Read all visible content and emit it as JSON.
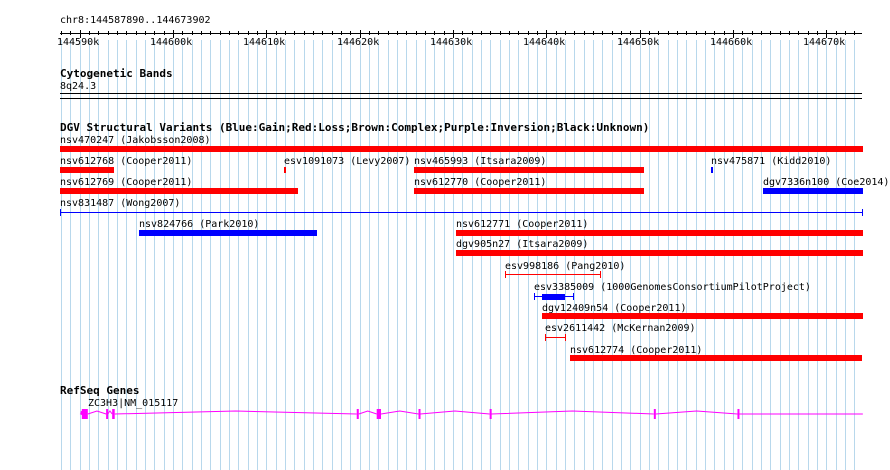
{
  "ruler": {
    "location": "chr8:144587890..144673902",
    "ticks": [
      "144590k",
      "144600k",
      "144610k",
      "144620k",
      "144630k",
      "144640k",
      "144650k",
      "144660k",
      "144670k"
    ]
  },
  "cytoband": {
    "title": "Cytogenetic Bands",
    "band": "8q24.3"
  },
  "dgv": {
    "title": "DGV Structural Variants (Blue:Gain;Red:Loss;Brown:Complex;Purple:Inversion;Black:Unknown)",
    "colors": {
      "gain": "#0000ff",
      "loss": "#ff0000"
    },
    "features": [
      {
        "label": "nsv470247 (Jakobsson2008)",
        "type": "loss",
        "start": 144587890,
        "end": 144673902,
        "style": "bar"
      },
      {
        "label": "nsv612768 (Cooper2011)",
        "type": "loss",
        "start": 144587890,
        "end": 144593650,
        "style": "bar"
      },
      {
        "label": "esv1091073 (Levy2007)",
        "type": "loss",
        "start": 144611910,
        "end": 144612050,
        "style": "bar"
      },
      {
        "label": "nsv465993 (Itsara2009)",
        "type": "loss",
        "start": 144625850,
        "end": 144650490,
        "style": "bar"
      },
      {
        "label": "nsv475871 (Kidd2010)",
        "type": "gain",
        "start": 144657670,
        "end": 144657830,
        "style": "bar"
      },
      {
        "label": "nsv612769 (Cooper2011)",
        "type": "loss",
        "start": 144587890,
        "end": 144613420,
        "style": "bar"
      },
      {
        "label": "nsv612770 (Cooper2011)",
        "type": "loss",
        "start": 144625850,
        "end": 144650490,
        "style": "bar"
      },
      {
        "label": "dgv7336n100 (Coe2014)",
        "type": "gain",
        "start": 144663180,
        "end": 144673902,
        "style": "bar"
      },
      {
        "label": "nsv831487 (Wong2007)",
        "type": "gain",
        "start": 144587890,
        "end": 144673902,
        "style": "line"
      },
      {
        "label": "nsv824766 (Park2010)",
        "type": "gain",
        "start": 144596320,
        "end": 144615400,
        "style": "bar"
      },
      {
        "label": "nsv612771 (Cooper2011)",
        "type": "loss",
        "start": 144630350,
        "end": 144673902,
        "style": "bar"
      },
      {
        "label": "dgv905n27 (Itsara2009)",
        "type": "loss",
        "start": 144630350,
        "end": 144673902,
        "style": "bar"
      },
      {
        "label": "esv998186 (Pang2010)",
        "type": "loss",
        "start": 144635540,
        "end": 144645830,
        "style": "line"
      },
      {
        "label": "esv3385009 (1000GenomesConsortiumPilotProject)",
        "type": "gain",
        "start": 144638620,
        "end": 144642900,
        "style": "line",
        "thick_start": 144639480,
        "thick_end": 144641940
      },
      {
        "label": "dgv12409n54 (Cooper2011)",
        "type": "loss",
        "start": 144639480,
        "end": 144673902,
        "style": "bar"
      },
      {
        "label": "esv2611442 (McKernan2009)",
        "type": "loss",
        "start": 144639800,
        "end": 144642040,
        "style": "line"
      },
      {
        "label": "nsv612774 (Cooper2011)",
        "type": "loss",
        "start": 144642580,
        "end": 144673902,
        "style": "bar"
      }
    ]
  },
  "refseq": {
    "title": "RefSeq Genes",
    "gene_label": "ZC3H3|NM_015117",
    "color": "#ff00ff",
    "start": 144590120,
    "end": 144673902,
    "exons": [
      [
        144590230,
        144590870
      ],
      [
        144592830,
        144593000
      ],
      [
        144593480,
        144593750
      ],
      [
        144619680,
        144619900
      ],
      [
        144621820,
        144622280
      ],
      [
        144626300,
        144626470
      ],
      [
        144633920,
        144634070
      ],
      [
        144651510,
        144651720
      ],
      [
        144660470,
        144660640
      ]
    ]
  }
}
